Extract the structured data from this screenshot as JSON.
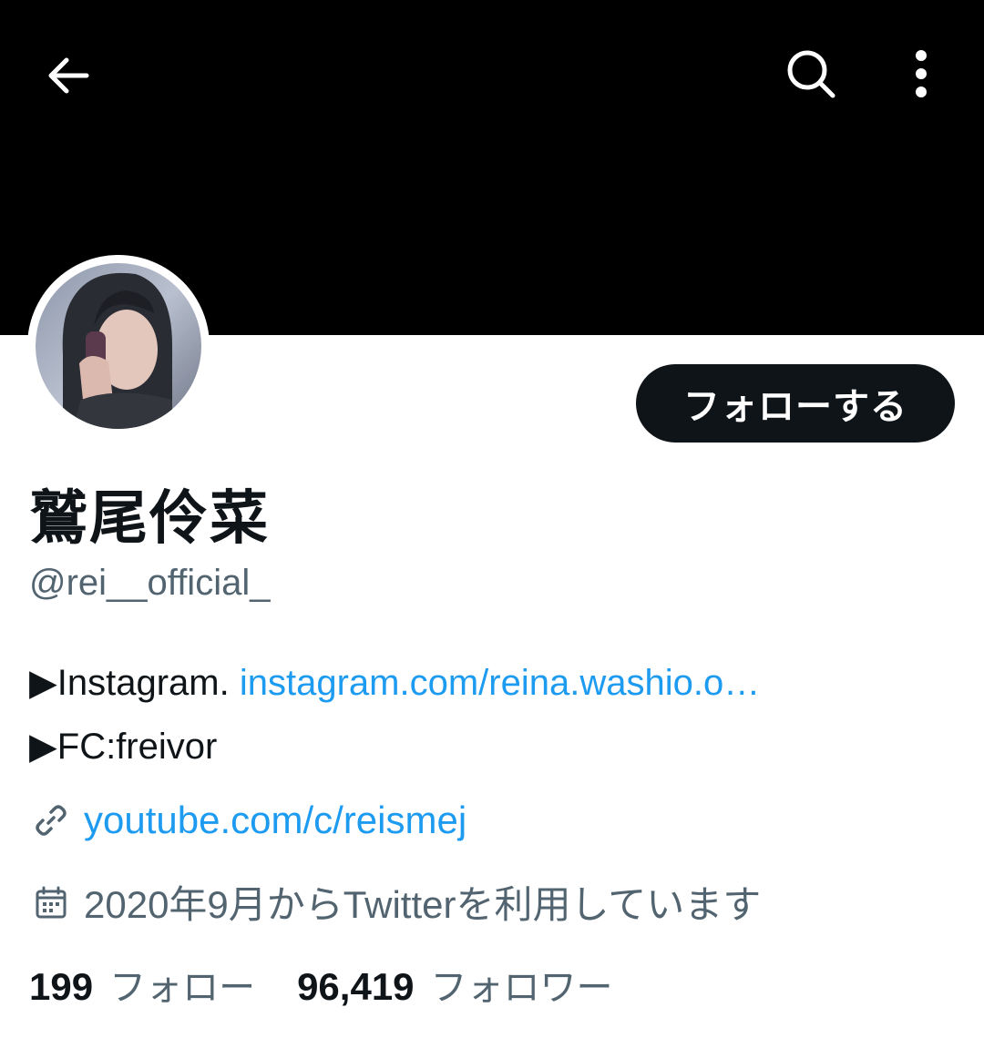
{
  "header": {
    "back_icon": "arrow-left-icon",
    "search_icon": "search-icon",
    "more_icon": "more-vertical-icon",
    "banner_color": "#000000"
  },
  "profile": {
    "display_name": "鷲尾伶菜",
    "handle": "@rei__official_",
    "follow_button_label": "フォローする",
    "bio": {
      "line1_prefix": "▶Instagram. ",
      "line1_link": "instagram.com/reina.washio.o…",
      "line2": "▶FC:freivor"
    },
    "website": "youtube.com/c/reismej",
    "joined": "2020年9月からTwitterを利用しています",
    "following_count": "199",
    "following_label": "フォロー",
    "followers_count": "96,419",
    "followers_label": "フォロワー"
  },
  "colors": {
    "link": "#1d9bf0",
    "secondary_text": "#536471",
    "primary_text": "#0f1419"
  }
}
